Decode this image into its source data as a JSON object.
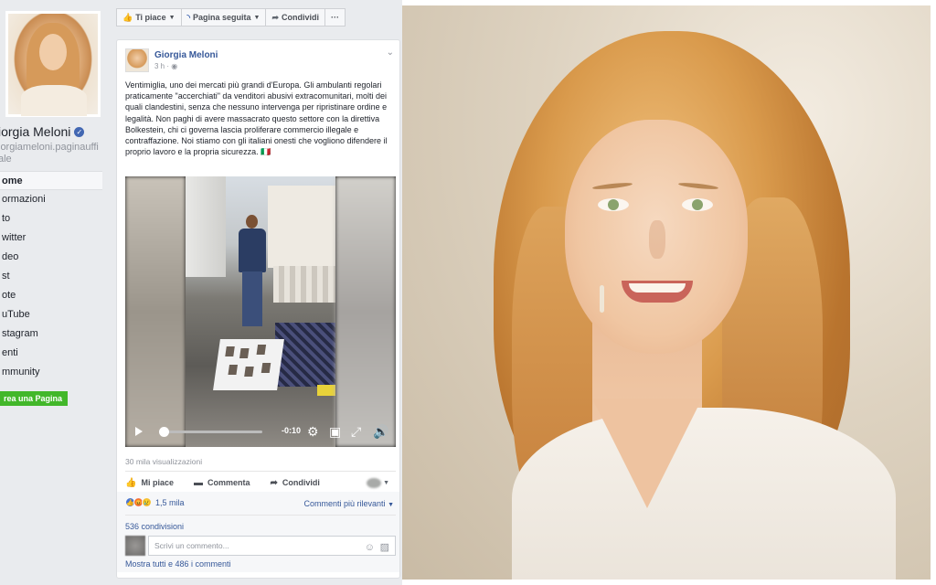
{
  "page": {
    "name": "Giorgia Meloni",
    "name_visible": "iorgia Meloni",
    "handle": "giorgiameloni.paginauffi ciale",
    "handle_visible": "iorgiameloni.paginauffi ale"
  },
  "nav": {
    "items": [
      "ome",
      "ormazioni",
      "to",
      "witter",
      "deo",
      "st",
      "ote",
      "uTube",
      "stagram",
      "enti",
      "mmunity"
    ],
    "create_page": "rea una Pagina"
  },
  "actions": {
    "like": "Ti piace",
    "following": "Pagina seguita",
    "share": "Condividi",
    "more": "···"
  },
  "post": {
    "author": "Giorgia Meloni",
    "time": "3 h ·",
    "text": "Ventimiglia, uno dei mercati più grandi d'Europa. Gli ambulanti regolari praticamente \"accerchiati\" da venditori abusivi extracomunitari, molti dei quali clandestini, senza che nessuno intervenga per ripristinare ordine e legalità. Non paghi di avere massacrato questo settore con la direttiva Bolkestein, chi ci governa lascia proliferare commercio illegale e contraffazione. Noi stiamo con gli italiani onesti che vogliono difendere il proprio lavoro e la propria sicurezza. 🇮🇹",
    "video": {
      "remaining_time": "-0:10",
      "progress": 0.0
    },
    "views": "30 mila visualizzazioni",
    "buttons": {
      "like": "Mi piace",
      "comment": "Commenta",
      "share": "Condividi"
    },
    "reactions_count": "1,5 mila",
    "sort": "Commenti più rilevanti",
    "shares": "536 condivisioni",
    "comment_placeholder": "Scrivi un commento...",
    "show_all": "Mostra tutti e 486 i commenti"
  },
  "icons": {
    "like": "thumbs-up-icon",
    "rss": "rss-icon",
    "share": "share-arrow-icon",
    "comment": "speech-bubble-icon",
    "play": "play-icon",
    "settings": "gear-icon",
    "theater": "theater-mode-icon",
    "fullscreen": "fullscreen-icon",
    "volume": "volume-icon",
    "emoji": "emoji-icon",
    "sticker": "sticker-icon"
  },
  "colors": {
    "facebook_blue": "#4267b2",
    "link_blue": "#365899",
    "green_button": "#42b72a",
    "background": "#e9ebee"
  }
}
